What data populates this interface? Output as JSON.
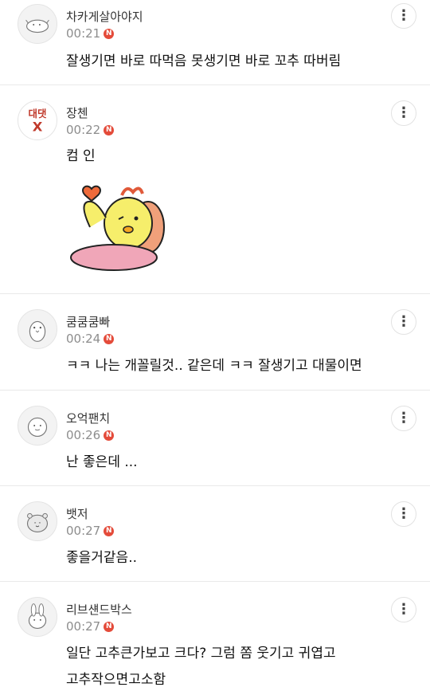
{
  "comments": [
    {
      "nickname": "차카게살아야지",
      "time": "00:21",
      "badge": "N",
      "text": "잘생기면 바로 따먹음 못생기면 바로 꼬추 따버림",
      "avatar_icon": "lizard-avatar-icon"
    },
    {
      "nickname": "장첸",
      "time": "00:22",
      "badge": "N",
      "text": "컴 인",
      "avatar_icon": "daedat-x-logo",
      "avatar_label": "대댓",
      "avatar_sub": "X",
      "sticker_icon": "waving-chick-sticker"
    },
    {
      "nickname": "쿰쿰쿰빠",
      "time": "00:24",
      "badge": "N",
      "text": "ㅋㅋ 나는 개꼴릴것.. 같은데 ㅋㅋ 잘생기고 대물이면",
      "avatar_icon": "penguin-avatar-icon"
    },
    {
      "nickname": "오억팬치",
      "time": "00:26",
      "badge": "N",
      "text": "난 좋은데 ...",
      "avatar_icon": "blob-avatar-icon"
    },
    {
      "nickname": "뱃저",
      "time": "00:27",
      "badge": "N",
      "text": "좋을거같음..",
      "avatar_icon": "hamster-avatar-icon"
    },
    {
      "nickname": "리브섄드박스",
      "time": "00:27",
      "badge": "N",
      "text_line1": "일단 고추큰가보고 크다? 그럼 쫌 웃기고 귀엽고",
      "text_line2": "고추작으면고소함",
      "avatar_icon": "bunny-avatar-icon"
    }
  ],
  "more_label": "⋮"
}
